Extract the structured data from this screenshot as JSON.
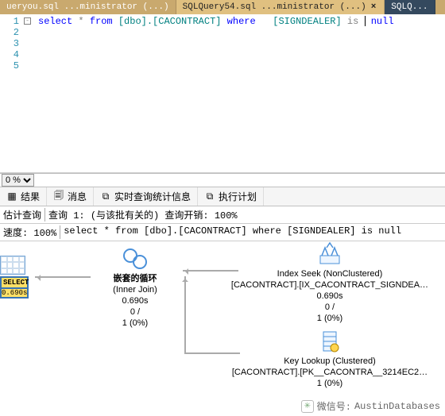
{
  "tabs": {
    "left_name": "ueryou.sql ...ministrator (...)",
    "mid_name": "SQLQuery54.sql ...ministrator (...)",
    "right_name": "SQLQ..."
  },
  "editor": {
    "lines": [
      "1",
      "2",
      "3",
      "4",
      "5"
    ],
    "sql": {
      "kw_select": "select",
      "star": " * ",
      "kw_from": "from ",
      "tbl": "[dbo].[CACONTRACT]",
      "kw_where": " where   ",
      "col": "[SIGNDEALER]",
      "kw_is": " is ",
      "kw_null": " null"
    }
  },
  "zoom": {
    "value": "0 %"
  },
  "result_tabs": {
    "results": "结果",
    "messages": "消息",
    "live_stats": "实时查询统计信息",
    "exec_plan": "执行计划"
  },
  "info": {
    "est_label": "估计查询",
    "query_line": "查询 1: (与该批有关的) 查询开销: 100%",
    "speed_label": "速度: 100%",
    "sql_text": "select * from [dbo].[CACONTRACT] where [SIGNDEALER] is null"
  },
  "plan": {
    "select": {
      "label": "SELECT",
      "time": "0.690s"
    },
    "nested_loop": {
      "title": "嵌套的循环",
      "sub": "(Inner Join)",
      "time": "0.690s",
      "rows": "0 /",
      "pct": "1 (0%)"
    },
    "index_seek": {
      "title": "Index Seek (NonClustered)",
      "sub": "[CACONTRACT].[IX_CACONTRACT_SIGNDEA…",
      "time": "0.690s",
      "rows": "0 /",
      "pct": "1 (0%)"
    },
    "key_lookup": {
      "title": "Key Lookup (Clustered)",
      "sub": "[CACONTRACT].[PK__CACONTRA__3214EC2…",
      "pct": "1 (0%)"
    }
  },
  "watermark": {
    "label": "微信号:",
    "value": "AustinDatabases"
  }
}
